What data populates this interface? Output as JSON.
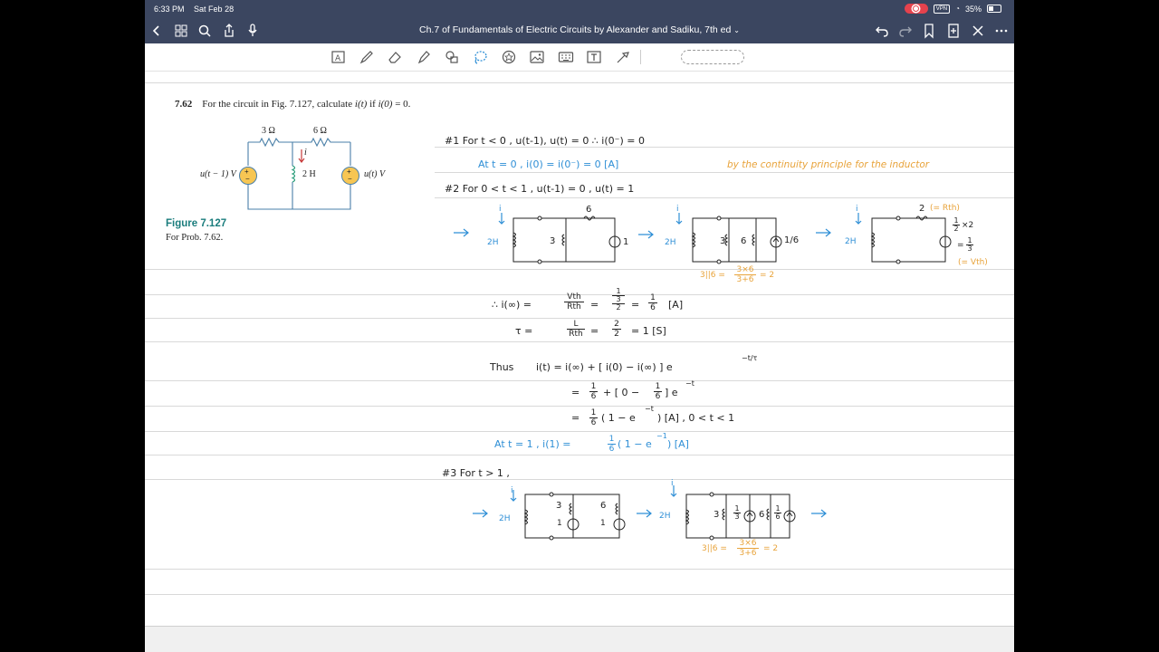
{
  "status_bar": {
    "time": "6:33 PM",
    "date": "Sat Feb 28",
    "vpn": "VPN",
    "battery": "35%"
  },
  "document": {
    "title": "Ch.7 of Fundamentals of Electric Circuits by Alexander and Sadiku, 7th ed"
  },
  "nav_icons": [
    "back-icon",
    "thumbnails-icon",
    "search-icon",
    "share-icon",
    "microphone-icon",
    "undo-icon",
    "redo-icon",
    "bookmark-icon",
    "add-page-icon",
    "close-icon",
    "more-icon"
  ],
  "tools": [
    "lasso-text-icon",
    "pen-icon",
    "eraser-icon",
    "highlighter-icon",
    "shapes-icon",
    "lasso-icon",
    "sticker-icon",
    "image-icon",
    "keyboard-icon",
    "text-box-icon",
    "laser-pointer-icon"
  ],
  "problem": {
    "number": "7.62",
    "text_before": "For the circuit in Fig. 7.127, calculate ",
    "it": "i(t)",
    "text_mid": " if ",
    "i0": "i(0)",
    "text_after": " = 0."
  },
  "figure": {
    "label": "Figure 7.127",
    "caption": "For Prob. 7.62.",
    "r1": "3 Ω",
    "r2": "6 Ω",
    "inductor": "2 H",
    "current": "i",
    "src_left": "u(t − 1) V",
    "src_right": "u(t) V",
    "plus": "+",
    "minus": "−"
  },
  "notes": {
    "l1": "#1  For t < 0 ,   u(t-1), u(t) = 0      ∴  i(0⁻) = 0",
    "l2": "At t = 0 ,   i(0) = i(0⁻) = 0  [A]",
    "l2b": "by the continuity principle for the inductor",
    "l3": "#2   For 0 < t < 1 ,      u(t-1) = 0  ,  u(t) = 1",
    "c1_top": "6",
    "c1_r": "3",
    "c1_src": "1",
    "ind_i": "i",
    "ind_2h": "2H",
    "c2_r1": "3",
    "c2_r2": "6",
    "c2_src": "1/6",
    "c2_note": "3||6 =",
    "c2_num": "3×6",
    "c2_den": "3+6",
    "c2_res": "= 2",
    "c3_top": "2",
    "c3_rth": "(= Rth)",
    "c3_calc": "×2",
    "c3_eq": "=",
    "c3_vth": "(= Vth)",
    "half": "1",
    "half_den": "2",
    "third": "1",
    "third_den": "3",
    "eq_inf": "∴  i(∞)  =",
    "vth": "Vth",
    "rth": "Rth",
    "eq_inf_res": "[A]",
    "eq_tau": "τ    =",
    "L": "L",
    "two": "2",
    "eq_tau_res": "=  1  [S]",
    "thus": "Thus",
    "eq_it1": "i(t)  =  i(∞) + [ i(0) − i(∞) ] e",
    "exp_tau": "−t/τ",
    "eq_it2a": "=",
    "eq_it2b": "+  [ 0 −",
    "eq_it2c": "] e",
    "exp_t": "−t",
    "eq_it3a": "=",
    "eq_it3b": "( 1 − e",
    "eq_it3c": ")  [A] ,  0 < t < 1",
    "l_at1": "At t = 1 ,   i(1) =",
    "l_at1b": "( 1 − e",
    "exp_1": "−1",
    "l_at1c": ")   [A]",
    "one": "1",
    "six": "6",
    "l4": "#3   For  t > 1 ,",
    "c4_r1": "3",
    "c4_r2": "6",
    "c4_s1": "1",
    "c4_s2": "1",
    "c5_r1": "3",
    "c5_r2": "6",
    "c5_note": "3||6 =",
    "c5_num": "3×6",
    "c5_den": "3+6",
    "c5_res": "= 2",
    "arrow": "→"
  }
}
